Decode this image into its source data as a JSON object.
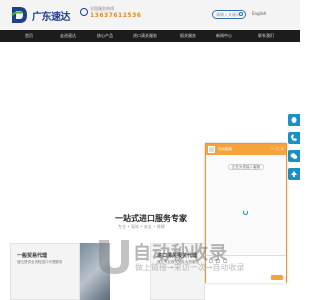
{
  "header": {
    "logo_text": "广东速达",
    "phone_label": "全国服务热线",
    "phone_number": "13637612536",
    "search_placeholder": "请输入关键词",
    "language": "English"
  },
  "nav": {
    "items": [
      "首页",
      "走进速达",
      "核心产品",
      "进口清关服务",
      "报关服务",
      "新闻中心",
      "联系我们"
    ]
  },
  "side_tabs": [
    "qq-icon",
    "phone-icon",
    "wechat-icon",
    "top-icon"
  ],
  "chat": {
    "title": "在线客服",
    "prompt_button": "正在为您接入客服",
    "controls": "— □ ×"
  },
  "section": {
    "title": "一站式进口服务专家",
    "subtitle": "专业 • 高效 • 安全 • 便捷"
  },
  "cards": [
    {
      "title": "一般贸易代理",
      "text": "速达提供全流程进口代理服务"
    },
    {
      "title": "进口清关报关代理",
      "text": "速达专业报关团队为您服务"
    }
  ],
  "watermark": {
    "text": "自动秒收录",
    "subtitle": "做上链接→来访一次→自动收录"
  },
  "colors": {
    "brand_blue": "#1f3f8a",
    "phone_orange": "#e08a1e",
    "nav_bg": "#1c1c1c",
    "chat_orange": "#f7a23a",
    "side_tab_blue": "#1a90c8"
  }
}
